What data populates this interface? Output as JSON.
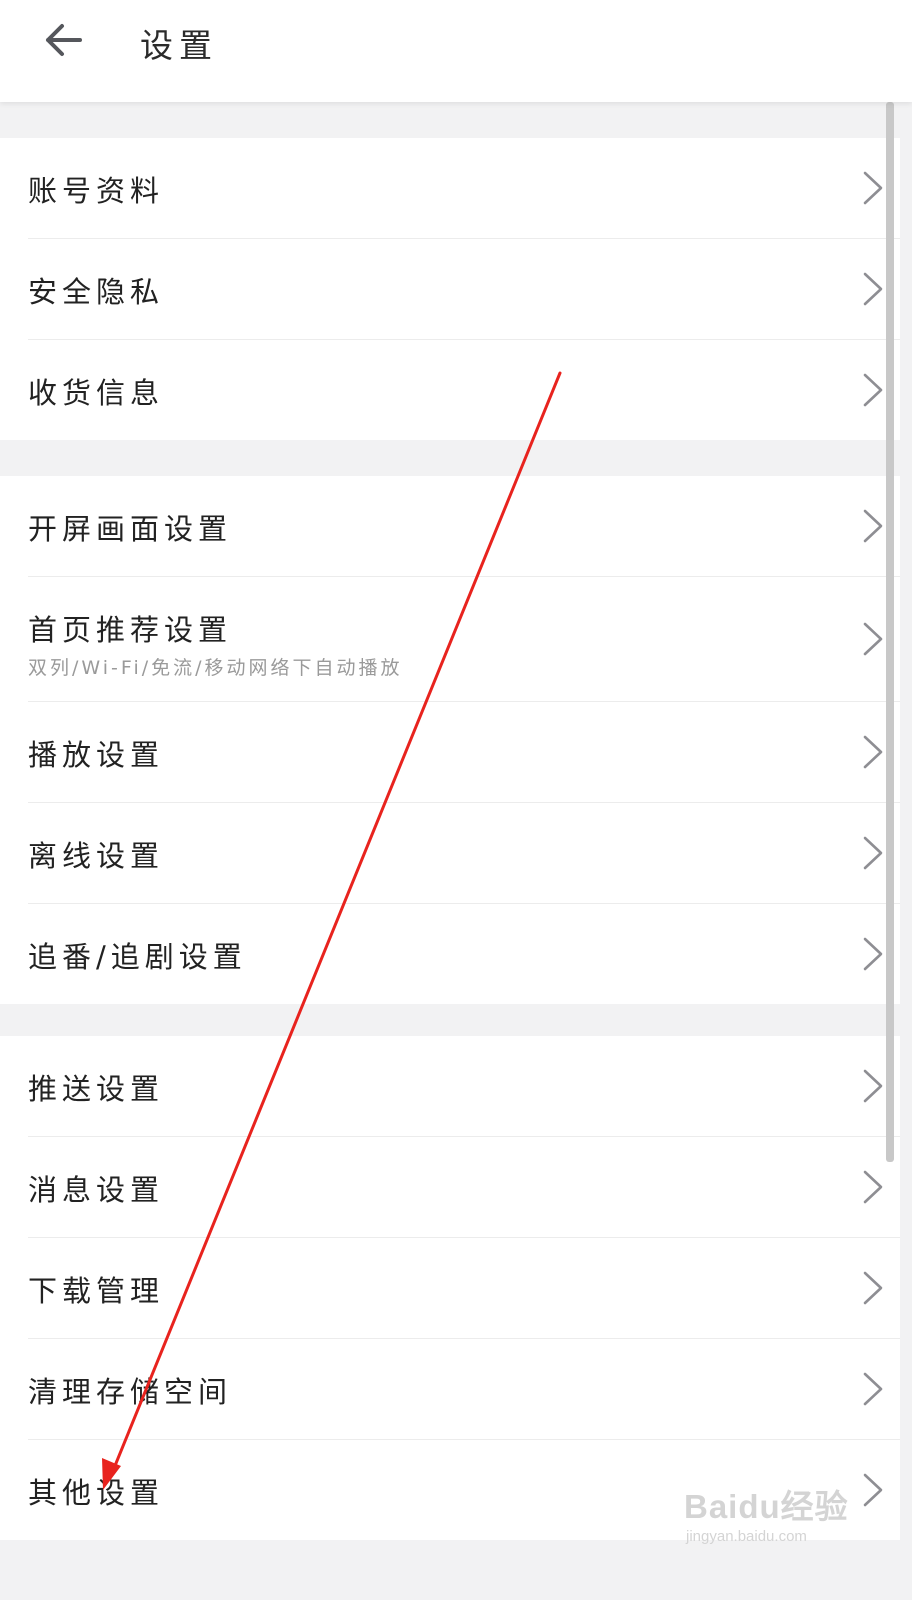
{
  "header": {
    "title": "设置"
  },
  "icons": {
    "back": "arrow-left-icon",
    "row_chevron": "chevron-right-icon"
  },
  "sections": [
    {
      "items": [
        {
          "label": "账号资料"
        },
        {
          "label": "安全隐私"
        },
        {
          "label": "收货信息"
        }
      ]
    },
    {
      "items": [
        {
          "label": "开屏画面设置"
        },
        {
          "label": "首页推荐设置",
          "subtitle": "双列/Wi-Fi/免流/移动网络下自动播放"
        },
        {
          "label": "播放设置"
        },
        {
          "label": "离线设置"
        },
        {
          "label": "追番/追剧设置"
        }
      ]
    },
    {
      "items": [
        {
          "label": "推送设置"
        },
        {
          "label": "消息设置"
        },
        {
          "label": "下载管理"
        },
        {
          "label": "清理存储空间"
        },
        {
          "label": "其他设置"
        }
      ]
    }
  ],
  "annotation": {
    "color": "#e8231e"
  },
  "watermark": {
    "brand": "Baidu经验",
    "url": "jingyan.baidu.com"
  }
}
